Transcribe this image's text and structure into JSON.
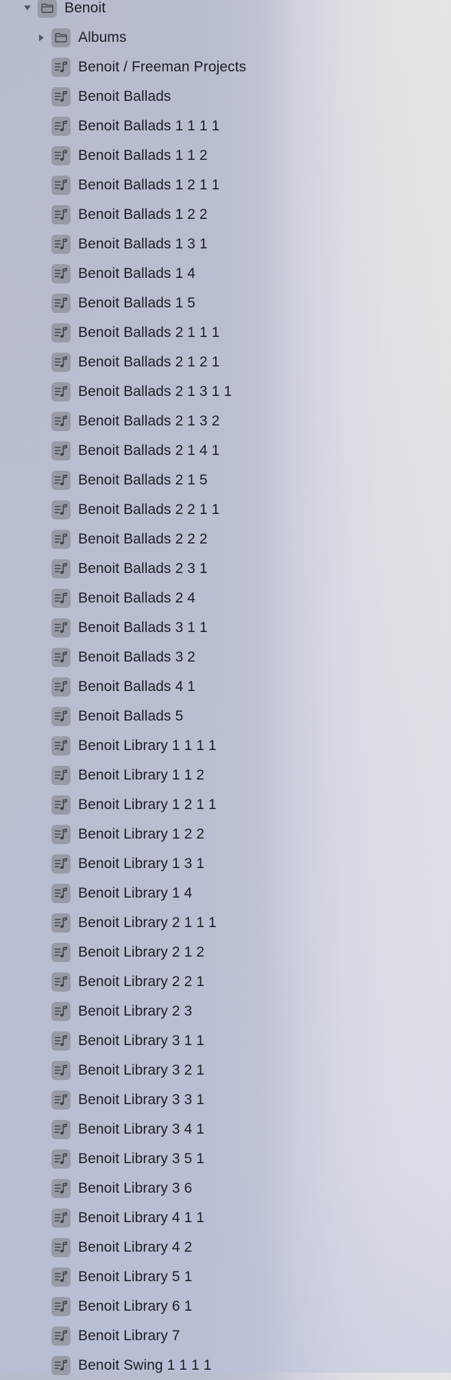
{
  "tree": {
    "root": {
      "label": "Benoit",
      "icon": "folder-icon",
      "expanded": true
    },
    "subfolder": {
      "label": "Albums",
      "icon": "folder-icon",
      "expanded": false
    },
    "playlists": [
      "Benoit / Freeman Projects",
      "Benoit Ballads",
      "Benoit Ballads 1 1 1 1",
      "Benoit Ballads 1 1 2",
      "Benoit Ballads 1 2 1 1",
      "Benoit Ballads 1 2 2",
      "Benoit Ballads 1 3 1",
      "Benoit Ballads 1 4",
      "Benoit Ballads 1 5",
      "Benoit Ballads 2 1 1 1",
      "Benoit Ballads 2 1 2 1",
      "Benoit Ballads 2 1 3 1 1",
      "Benoit Ballads 2 1 3 2",
      "Benoit Ballads 2 1 4 1",
      "Benoit Ballads 2 1 5",
      "Benoit Ballads 2 2 1 1",
      "Benoit Ballads 2 2 2",
      "Benoit Ballads 2 3 1",
      "Benoit Ballads 2 4",
      "Benoit Ballads 3 1 1",
      "Benoit Ballads 3 2",
      "Benoit Ballads 4 1",
      "Benoit Ballads 5",
      "Benoit Library 1 1 1 1",
      "Benoit Library 1 1 2",
      "Benoit Library 1 2 1 1",
      "Benoit Library 1 2 2",
      "Benoit Library 1 3 1",
      "Benoit Library 1 4",
      "Benoit Library 2 1 1 1",
      "Benoit Library 2 1 2",
      "Benoit Library 2 2 1",
      "Benoit Library 2 3",
      "Benoit Library 3 1 1",
      "Benoit Library 3 2 1",
      "Benoit Library 3 3 1",
      "Benoit Library 3 4 1",
      "Benoit Library 3 5 1",
      "Benoit Library 3 6",
      "Benoit Library 4 1 1",
      "Benoit Library 4 2",
      "Benoit Library 5 1",
      "Benoit Library 6 1",
      "Benoit Library 7",
      "Benoit Swing 1 1 1 1"
    ],
    "playlist_icon": "playlist-icon"
  },
  "colors": {
    "icon_bg": "#989aa5",
    "icon_fg": "#3f414b",
    "disclosure": "#55575f",
    "text": "#1d1d24"
  }
}
